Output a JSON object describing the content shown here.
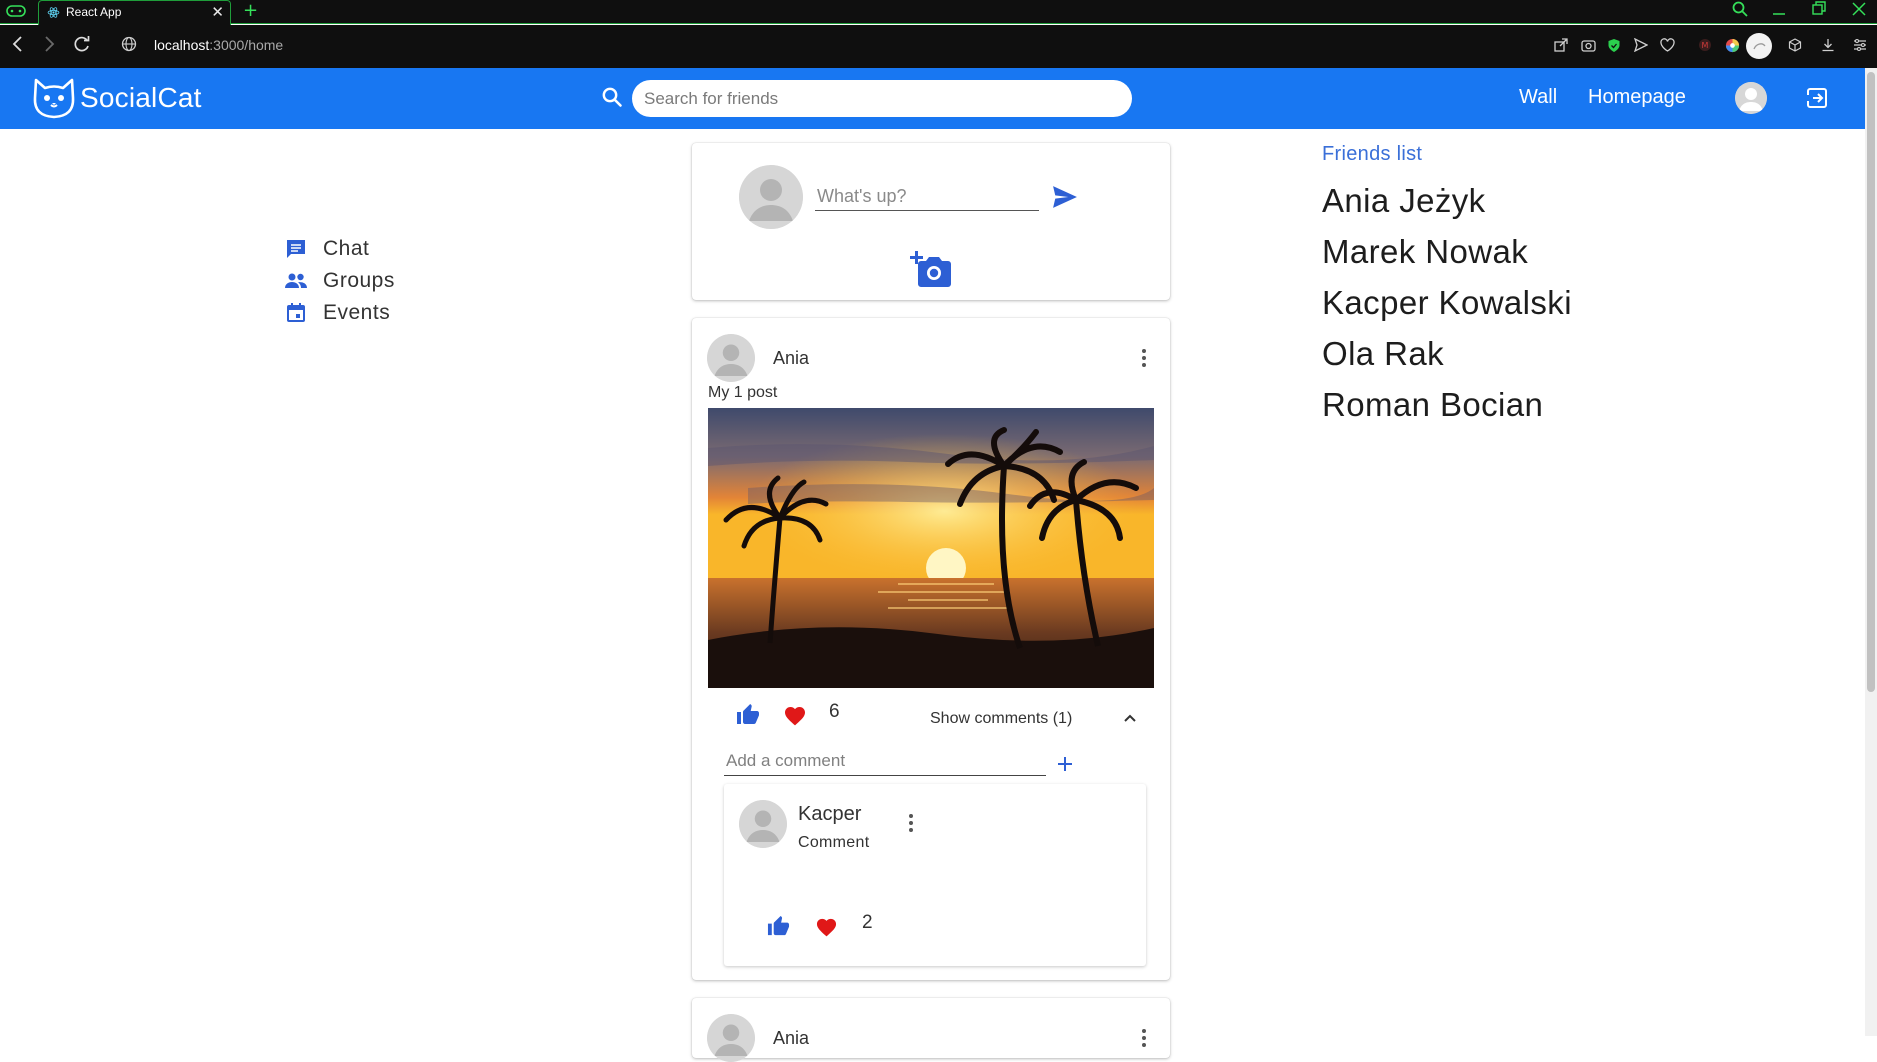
{
  "browser": {
    "tab_title": "React App",
    "tab_close": "✕",
    "new_tab": "+",
    "url_host": "localhost",
    "url_path": ":3000/home"
  },
  "header": {
    "brand": "SocialCat",
    "search_placeholder": "Search for friends",
    "nav": [
      "Wall",
      "Homepage"
    ],
    "accent_color": "#1877f2"
  },
  "sidebar": {
    "items": [
      {
        "label": "Chat",
        "icon": "chat-icon"
      },
      {
        "label": "Groups",
        "icon": "groups-icon"
      },
      {
        "label": "Events",
        "icon": "calendar-icon"
      }
    ]
  },
  "composer": {
    "placeholder": "What's up?"
  },
  "post": {
    "author": "Ania",
    "text": "My 1 post",
    "reactions": "6",
    "show_comments": "Show comments (1)",
    "comment_placeholder": "Add a comment",
    "comment": {
      "author": "Kacper",
      "text": "Comment",
      "reactions": "2"
    }
  },
  "next_post": {
    "author": "Ania"
  },
  "friends": {
    "title": "Friends list",
    "items": [
      "Ania Jeżyk",
      "Marek Nowak",
      "Kacper Kowalski",
      "Ola Rak",
      "Roman Bocian"
    ]
  }
}
